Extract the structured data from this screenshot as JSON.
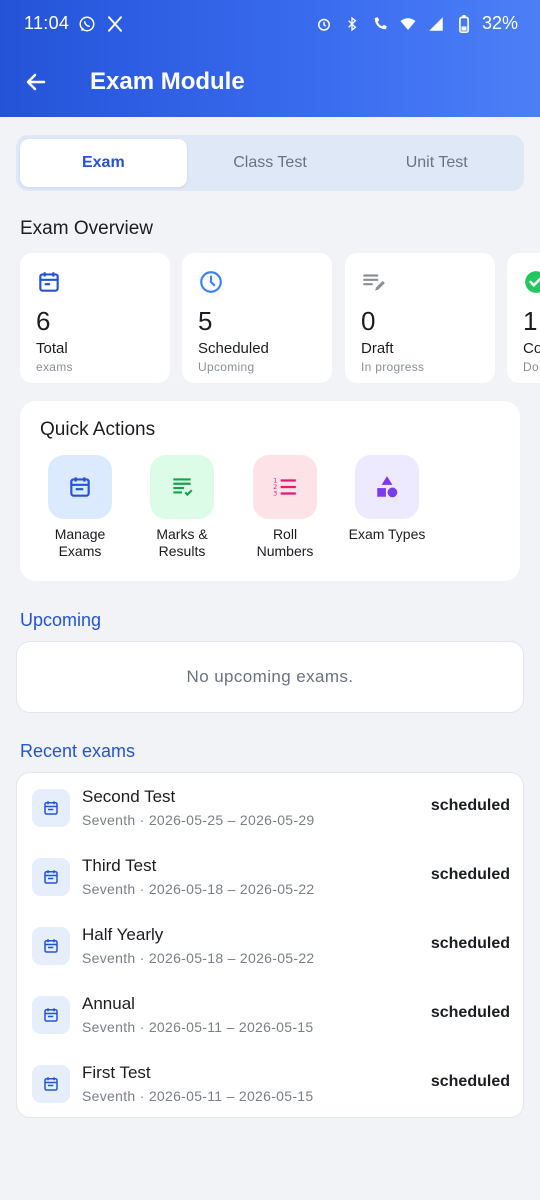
{
  "status_bar": {
    "time": "11:04",
    "battery": "32%"
  },
  "app_bar": {
    "title": "Exam Module",
    "back_icon": "arrow-left-icon"
  },
  "tabs": [
    {
      "label": "Exam",
      "active": true
    },
    {
      "label": "Class Test",
      "active": false
    },
    {
      "label": "Unit Test",
      "active": false
    }
  ],
  "overview": {
    "title": "Exam Overview",
    "cards": [
      {
        "icon": "calendar-icon",
        "color": "#2453d8",
        "value": "6",
        "label": "Total",
        "sub": "exams"
      },
      {
        "icon": "clock-icon",
        "color": "#3b82f6",
        "value": "5",
        "label": "Scheduled",
        "sub": "Upcoming"
      },
      {
        "icon": "edit-list-icon",
        "color": "#8a8f98",
        "value": "0",
        "label": "Draft",
        "sub": "In progress"
      },
      {
        "icon": "check-circle-icon",
        "color": "#22c55e",
        "value": "1",
        "label": "Co",
        "sub": "Do"
      }
    ]
  },
  "quick_actions": {
    "title": "Quick Actions",
    "items": [
      {
        "label_line1": "Manage",
        "label_line2": "Exams",
        "icon": "calendar-icon",
        "bg": "#dbeafe",
        "color": "#2453d8"
      },
      {
        "label_line1": "Marks &",
        "label_line2": "Results",
        "icon": "checklist-icon",
        "bg": "#dcfce7",
        "color": "#16a34a"
      },
      {
        "label_line1": "Roll",
        "label_line2": "Numbers",
        "icon": "numbered-list-icon",
        "bg": "#fde2e7",
        "color": "#e11d73"
      },
      {
        "label_line1": "Exam Types",
        "label_line2": "",
        "icon": "shapes-icon",
        "bg": "#ede9fe",
        "color": "#7c3aed"
      }
    ]
  },
  "upcoming": {
    "title": "Upcoming",
    "empty_text": "No upcoming exams."
  },
  "recent": {
    "title": "Recent exams",
    "items": [
      {
        "name": "Second Test",
        "meta": "Seventh · 2026-05-25 – 2026-05-29",
        "status": "scheduled"
      },
      {
        "name": "Third Test",
        "meta": "Seventh · 2026-05-18 – 2026-05-22",
        "status": "scheduled"
      },
      {
        "name": "Half Yearly",
        "meta": "Seventh · 2026-05-18 – 2026-05-22",
        "status": "scheduled"
      },
      {
        "name": "Annual",
        "meta": "Seventh · 2026-05-11 – 2026-05-15",
        "status": "scheduled"
      },
      {
        "name": "First Test",
        "meta": "Seventh · 2026-05-11 – 2026-05-15",
        "status": "scheduled"
      }
    ]
  },
  "colors": {
    "primary": "#2453d8",
    "background": "#f1f3f7"
  }
}
